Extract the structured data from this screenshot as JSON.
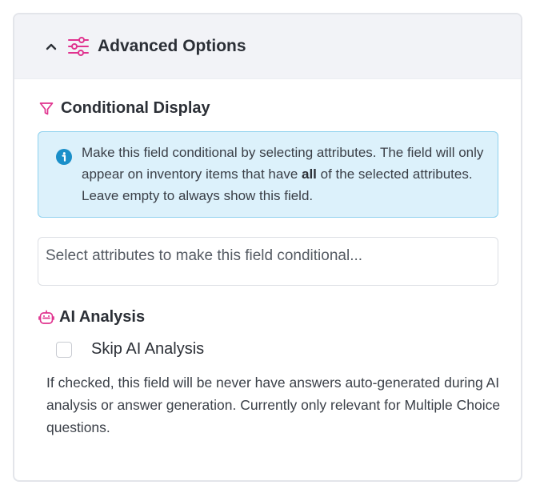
{
  "advanced": {
    "title": "Advanced Options",
    "icons": {
      "toggle": "chevron-up-icon",
      "section": "sliders-icon"
    }
  },
  "conditional": {
    "title": "Conditional Display",
    "icon": "filter-icon",
    "info": {
      "icon": "info-icon",
      "text_before": "Make this field conditional by selecting attributes. The field will only appear on inventory items that have ",
      "text_bold": "all",
      "text_after": " of the selected attributes. Leave empty to always show this field."
    },
    "select": {
      "placeholder": "Select attributes to make this field conditional..."
    }
  },
  "ai": {
    "title": "AI Analysis",
    "icon": "robot-icon",
    "skip_label": "Skip AI Analysis",
    "skip_checked": false,
    "help": "If checked, this field will be never have answers auto-generated during AI analysis or answer generation. Currently only relevant for Multiple Choice questions."
  },
  "colors": {
    "accent": "#e0338f",
    "info_bg": "#dcf1fb",
    "info_border": "#8fd1ee",
    "info_icon": "#1a8fc9",
    "header_bg": "#f2f3f7"
  }
}
